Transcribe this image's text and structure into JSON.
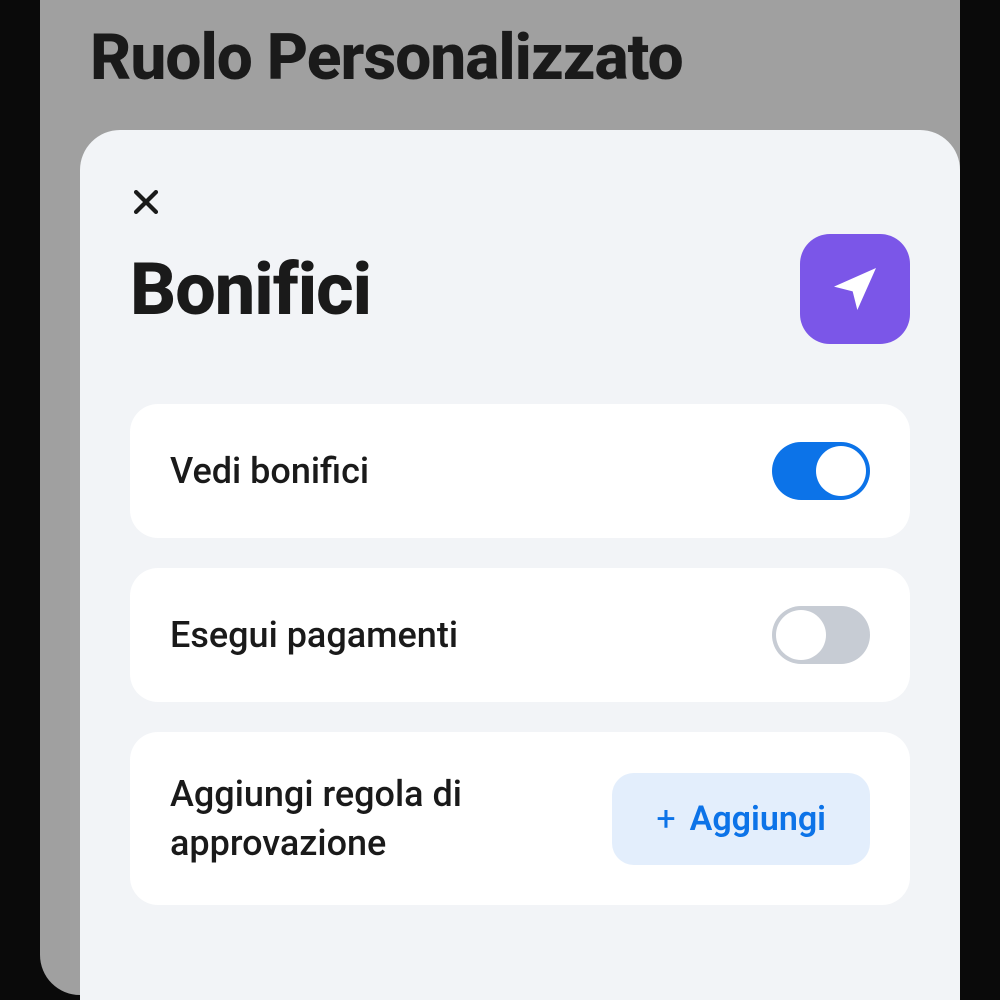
{
  "background": {
    "title": "Ruolo Personalizzato"
  },
  "modal": {
    "title": "Bonifici",
    "icon": "send-icon",
    "options": [
      {
        "label": "Vedi bonifici",
        "enabled": true
      },
      {
        "label": "Esegui pagamenti",
        "enabled": false
      }
    ],
    "approval_rule": {
      "label": "Aggiungi regola di approvazione",
      "button_label": "Aggiungi"
    }
  },
  "colors": {
    "accent_purple": "#7b56e8",
    "accent_blue": "#0c73e8",
    "button_bg": "#e3eefc",
    "toggle_off": "#c7ccd4"
  }
}
